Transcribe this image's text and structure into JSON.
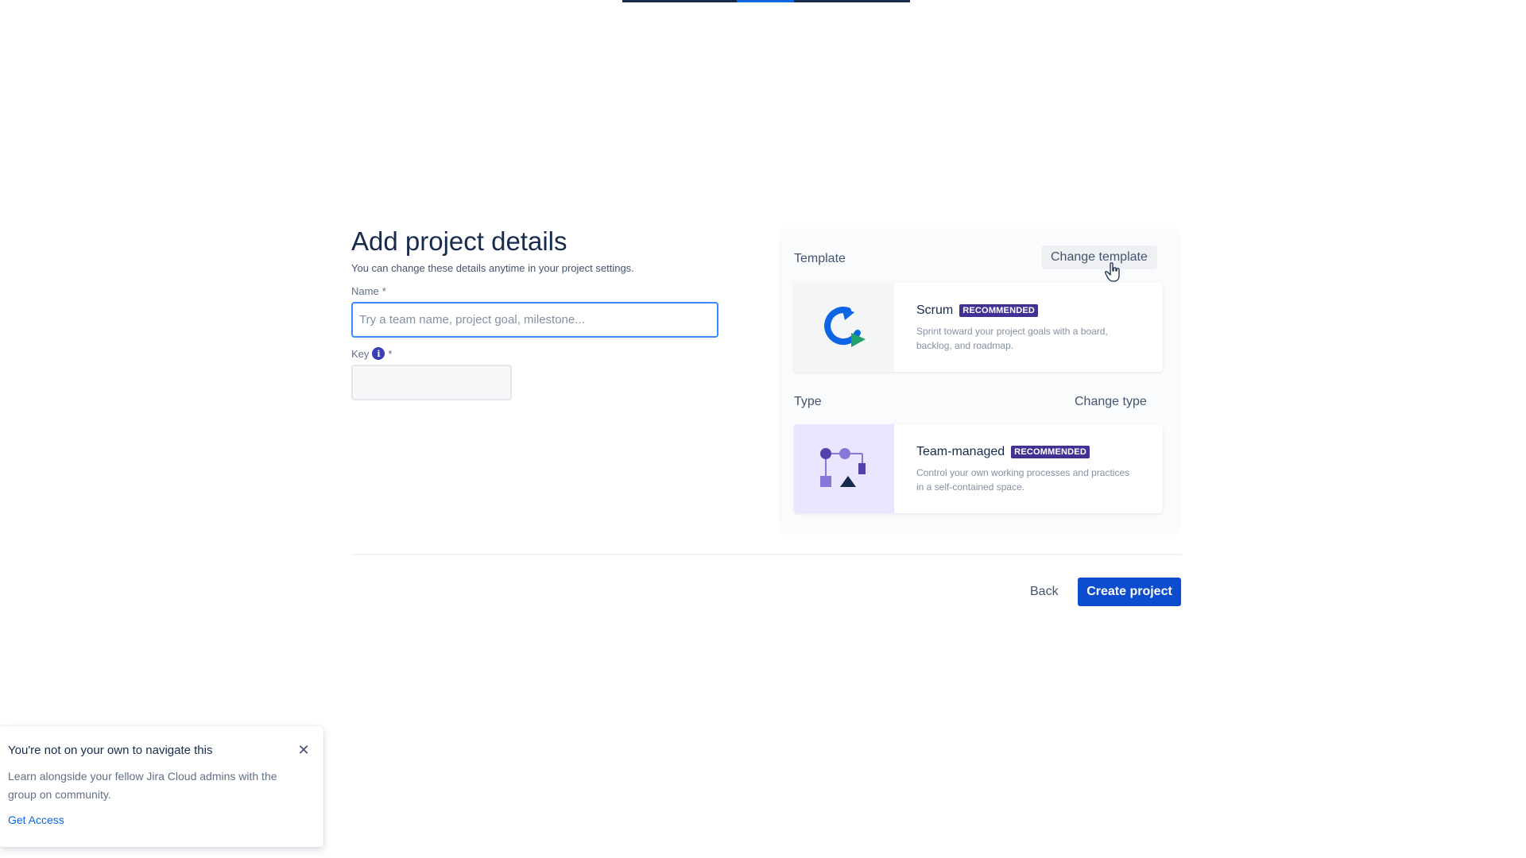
{
  "progress": {
    "current_step_fraction": 0.5
  },
  "details": {
    "title": "Add project details",
    "subtitle": "You can change these details anytime in your project settings.",
    "name_label": "Name",
    "name_required": "*",
    "name_placeholder": "Try a team name, project goal, milestone...",
    "name_value": "",
    "key_label": "Key",
    "key_required": "*",
    "key_value": ""
  },
  "template": {
    "label": "Template",
    "change_label": "Change template",
    "card": {
      "title": "Scrum",
      "badge": "RECOMMENDED",
      "description": "Sprint toward your project goals with a board, backlog, and roadmap."
    }
  },
  "type": {
    "label": "Type",
    "change_label": "Change type",
    "card": {
      "title": "Team-managed",
      "badge": "RECOMMENDED",
      "description": "Control your own working processes and practices in a self-contained space."
    }
  },
  "footer": {
    "back_label": "Back",
    "create_label": "Create project"
  },
  "flag": {
    "title": "You're not on your own to navigate this",
    "body": "Learn alongside your fellow Jira Cloud admins with the group on community.",
    "link_label": "Get Access",
    "close_icon": "close-icon"
  },
  "colors": {
    "primary_button": "#0c4ccf",
    "badge": "#403294",
    "focus_border": "#388bff",
    "link": "#0c66e4"
  }
}
